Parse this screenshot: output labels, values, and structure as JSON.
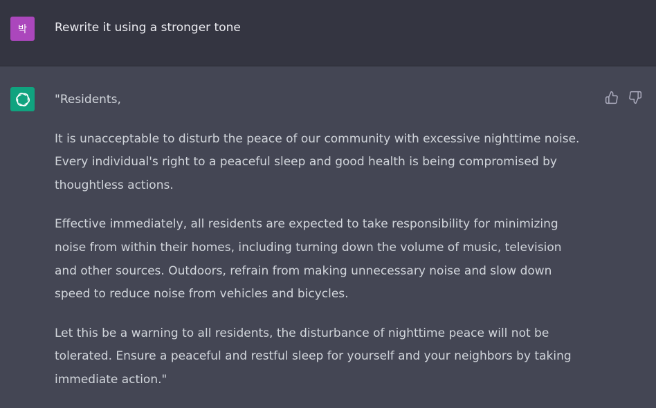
{
  "user_message": {
    "avatar_text": "박",
    "avatar_color": "#ab47bc",
    "text": "Rewrite it using a stronger tone"
  },
  "assistant_message": {
    "avatar_icon": "openai-logo-icon",
    "avatar_color": "#10a37f",
    "paragraphs": [
      "\"Residents,",
      "It is unacceptable to disturb the peace of our community with excessive nighttime noise.\nEvery individual's right to a peaceful sleep and good health is being compromised by\nthoughtless actions.",
      "Effective immediately, all residents are expected to take responsibility for minimizing\nnoise from within their homes, including turning down the volume of music, television\nand other sources. Outdoors, refrain from making unnecessary noise and slow down\nspeed to reduce noise from vehicles and bicycles.",
      "Let this be a warning to all residents, the disturbance of nighttime peace will not be\ntolerated. Ensure a peaceful and restful sleep for yourself and your neighbors by taking\nimmediate action.\""
    ]
  },
  "feedback": {
    "thumbs_up_icon": "thumbs-up-icon",
    "thumbs_down_icon": "thumbs-down-icon"
  },
  "colors": {
    "user_bg": "#343541",
    "assistant_bg": "#444654",
    "text": "#d1d5db"
  }
}
